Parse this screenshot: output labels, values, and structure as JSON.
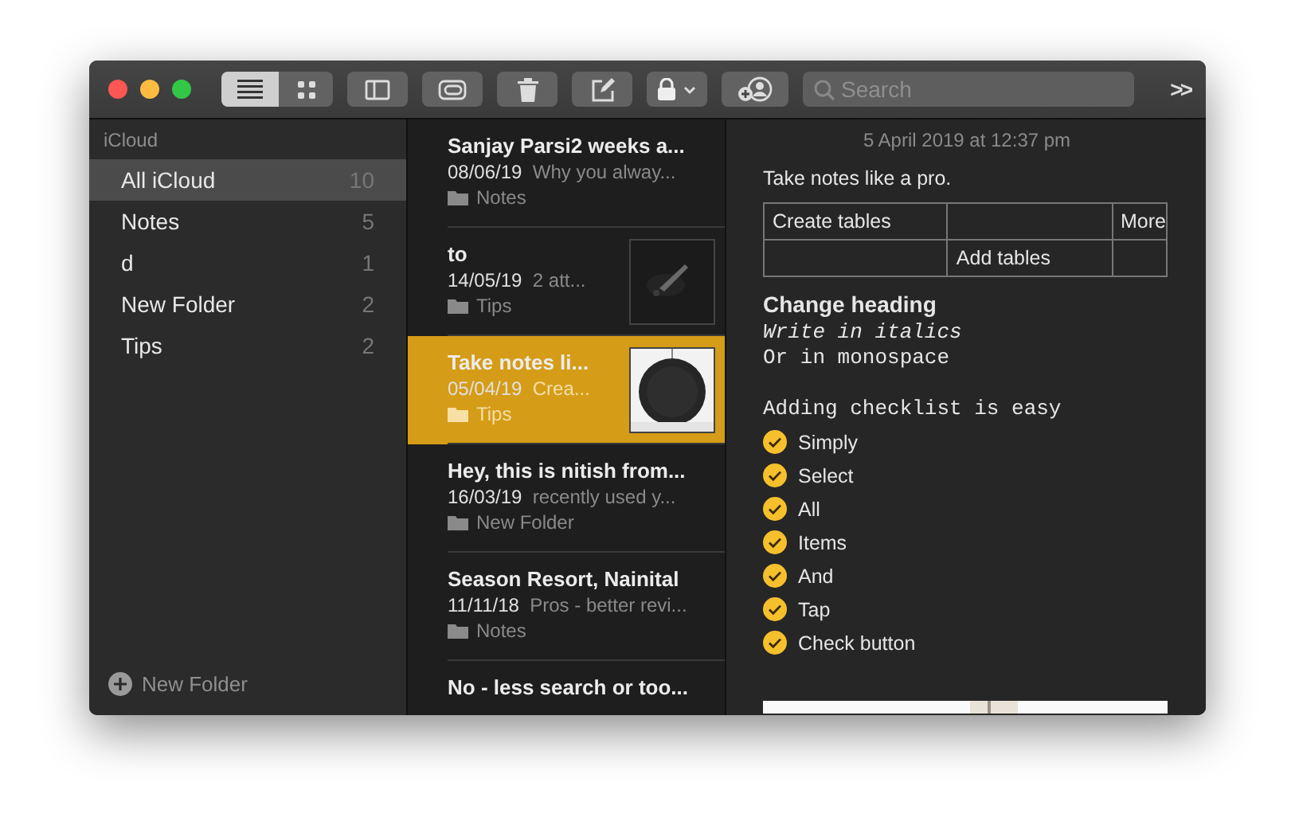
{
  "toolbar": {
    "view_buttons": [
      {
        "kind": "list",
        "selected": true
      },
      {
        "kind": "gallery",
        "selected": false
      }
    ],
    "buttons": [
      {
        "kind": "sidebar"
      },
      {
        "kind": "attachments"
      },
      {
        "kind": "delete"
      },
      {
        "kind": "compose"
      },
      {
        "kind": "lock"
      },
      {
        "kind": "collaborate"
      }
    ],
    "search": {
      "placeholder": "Search"
    },
    "overflow": ">>"
  },
  "sidebar": {
    "header": "iCloud",
    "items": [
      {
        "label": "All iCloud",
        "count": "10",
        "selected": true
      },
      {
        "label": "Notes",
        "count": "5",
        "selected": false
      },
      {
        "label": "d",
        "count": "1",
        "selected": false
      },
      {
        "label": "New Folder",
        "count": "2",
        "selected": false
      },
      {
        "label": "Tips",
        "count": "2",
        "selected": false
      }
    ],
    "footer": "New Folder"
  },
  "notes": [
    {
      "title": "Sanjay Parsi2 weeks a...",
      "date": "08/06/19",
      "snippet": "Why you alway...",
      "folder": "Notes",
      "selected": false
    },
    {
      "title": "to",
      "date": "14/05/19",
      "snippet": "2 att...",
      "folder": "Tips",
      "selected": false,
      "thumbnail": {
        "kind": "picture"
      }
    },
    {
      "title": "Take notes li...",
      "date": "05/04/19",
      "snippet": "Crea...",
      "folder": "Tips",
      "selected": true,
      "thumbnail": {
        "kind": "picture"
      }
    },
    {
      "title": "Hey, this is nitish from...",
      "date": "16/03/19",
      "snippet": "recently used y...",
      "folder": "New Folder",
      "selected": false
    },
    {
      "title": "Season Resort, Nainital",
      "date": "11/11/18",
      "snippet": "Pros - better revi...",
      "folder": "Notes",
      "selected": false
    },
    {
      "title": "No - less search or too...",
      "selected": false
    }
  ],
  "note": {
    "date": "5 April 2019 at 12:37 pm",
    "blocks": [
      {
        "kind": "text",
        "text": "Take notes like a pro."
      },
      {
        "kind": "table",
        "rows": [
          [
            "Create tables",
            "",
            "More"
          ],
          [
            "",
            "Add tables",
            ""
          ]
        ]
      },
      {
        "kind": "heading",
        "text": "Change heading"
      },
      {
        "kind": "italic-mono",
        "text": "Write in italics"
      },
      {
        "kind": "mono",
        "text": "Or in monospace"
      },
      {
        "kind": "mono-spaced",
        "text": "Adding checklist is easy"
      },
      {
        "kind": "checklist",
        "items": [
          {
            "text": "Simply",
            "checked": true
          },
          {
            "text": "Select",
            "checked": true
          },
          {
            "text": "All",
            "checked": true
          },
          {
            "text": "Items",
            "checked": true
          },
          {
            "text": "And",
            "checked": true
          },
          {
            "text": "Tap",
            "checked": true
          },
          {
            "text": "Check button",
            "checked": true
          }
        ]
      },
      {
        "kind": "picture"
      }
    ]
  }
}
